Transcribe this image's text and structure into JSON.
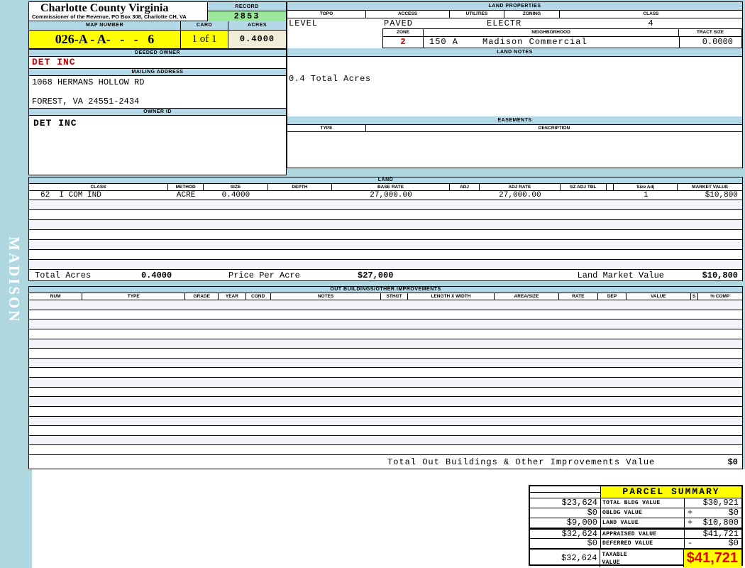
{
  "sidebar": {
    "district": "MADISON"
  },
  "header": {
    "county": "Charlotte County Virginia",
    "commissioner": "Commissioner of the Revenue, PO Box 308, Charlotte CH, VA",
    "record_label": "RECORD",
    "record_value": "2853",
    "map_number_label": "MAP NUMBER",
    "map_number": "026-A - A-   -   -   6",
    "card_label": "CARD",
    "card": "1 of 1",
    "acres_label": "ACRES",
    "acres": "0.4000"
  },
  "owner": {
    "deeded_owner_label": "DEEDED OWNER",
    "deeded_owner": "DET INC",
    "mailing_address_label": "MAILING ADDRESS",
    "address_line1": "1068 HERMANS HOLLOW RD",
    "address_line2": "FOREST, VA 24551-2434",
    "owner_id_label": "OWNER ID",
    "owner_id": "DET INC"
  },
  "land_properties": {
    "title": "LAND PROPERTIES",
    "topo_label": "TOPO",
    "topo": "LEVEL",
    "access_label": "ACCESS",
    "access": "PAVED",
    "utilities_label": "UTILITIES",
    "utilities": "ELECTR",
    "zoning_label": "ZONING",
    "zoning": "",
    "class_label": "CLASS",
    "class": "4",
    "zone_label": "ZONE",
    "zone": "2",
    "neighborhood_label": "NEIGHBORHOOD",
    "neighborhood_code": "150 A",
    "neighborhood": "Madison Commercial",
    "tract_size_label": "TRACT SIZE",
    "tract_size": "0.0000"
  },
  "land_notes": {
    "title": "LAND NOTES",
    "note": "0.4 Total Acres"
  },
  "easements": {
    "title": "EASEMENTS",
    "type_label": "TYPE",
    "description_label": "DESCRIPTION"
  },
  "land_table": {
    "title": "LAND",
    "columns": [
      "CLASS",
      "METHOD",
      "SIZE",
      "DEPTH",
      "BASE RATE",
      "ADJ",
      "ADJ RATE",
      "SZ ADJ TBL",
      "",
      "Size Adj",
      "MARKET VALUE"
    ],
    "rows": [
      [
        "62  I COM IND",
        "ACRE",
        "0.4000",
        "",
        "27,000.00",
        "",
        "27,000.00",
        "",
        "",
        "1",
        "$10,800"
      ]
    ],
    "empty_row_count": 7,
    "totals": {
      "total_acres_label": "Total Acres",
      "total_acres": "0.4000",
      "price_per_acre_label": "Price Per Acre",
      "price_per_acre": "$27,000",
      "market_value_label": "Land Market Value",
      "market_value": "$10,800"
    }
  },
  "out_buildings": {
    "title": "OUT BUILDINGS/OTHER IMPROVEMENTS",
    "columns": [
      "NUM",
      "TYPE",
      "GRADE",
      "YEAR",
      "COND",
      "NOTES",
      "STHGT",
      "LENGTH X WIDTH",
      "AREA/SIZE",
      "RATE",
      "DEP",
      "VALUE",
      "S",
      "% COMP"
    ],
    "rows": [],
    "empty_row_count": 16,
    "total_label": "Total Out Buildings & Other Improvements Value",
    "total_value": "$0"
  },
  "parcel_summary": {
    "title": "PARCEL SUMMARY",
    "rows": [
      {
        "prior": "$23,624",
        "label": "TOTAL BLDG VALUE",
        "op": "",
        "value": "$30,921"
      },
      {
        "prior": "$0",
        "label": "OBLDG VALUE",
        "op": "+",
        "value": "$0"
      },
      {
        "prior": "$9,000",
        "label": "LAND VALUE",
        "op": "+",
        "value": "$10,800"
      },
      {
        "prior": "$32,624",
        "label": "APPRAISED VALUE",
        "op": "",
        "value": "$41,721"
      },
      {
        "prior": "$0",
        "label": "DEFERRED VALUE",
        "op": "-",
        "value": "$0"
      },
      {
        "prior": "$32,624",
        "label": "TAXABLE VALUE",
        "op": "",
        "value": "$41,721"
      }
    ]
  },
  "colors": {
    "page_background": "#AFD7E0",
    "section_header_blue": "#B3D9E8",
    "highlight_yellow": "#FFFF00",
    "record_green": "#9BE79B",
    "acres_cream": "#F0EDD8",
    "owner_red": "#C00000",
    "taxable_red": "#E60000",
    "alt_row": "#F2F4F9"
  }
}
